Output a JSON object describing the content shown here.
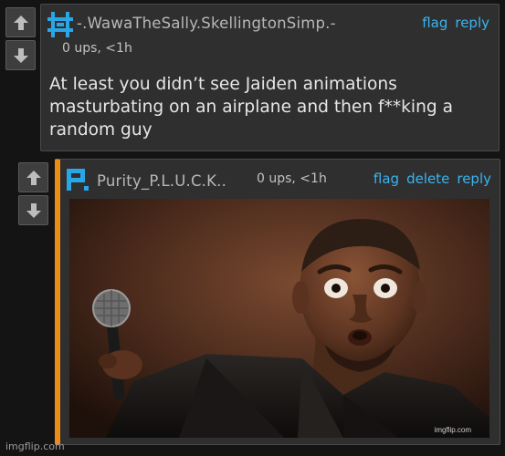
{
  "comment1": {
    "username": "-.WawaTheSally.SkellingtonSimp.-",
    "meta": "0 ups, <1h",
    "actions": [
      "flag",
      "reply"
    ],
    "text": "At least you didn’t see Jaiden animations masturbating on an airplane and then f**king a random guy",
    "avatar_color": "#29a6e6"
  },
  "comment2": {
    "username": "Purity_P.L.U.C.K..",
    "meta": "0 ups, <1h",
    "actions": [
      "flag",
      "delete",
      "reply"
    ],
    "avatar_color": "#29a6e6",
    "accent_color": "#ec8c16",
    "image_watermark": "imgflip.com"
  },
  "vote_icons": [
    "upvote-arrow-icon",
    "downvote-arrow-icon"
  ],
  "watermark": "imgflip.com"
}
